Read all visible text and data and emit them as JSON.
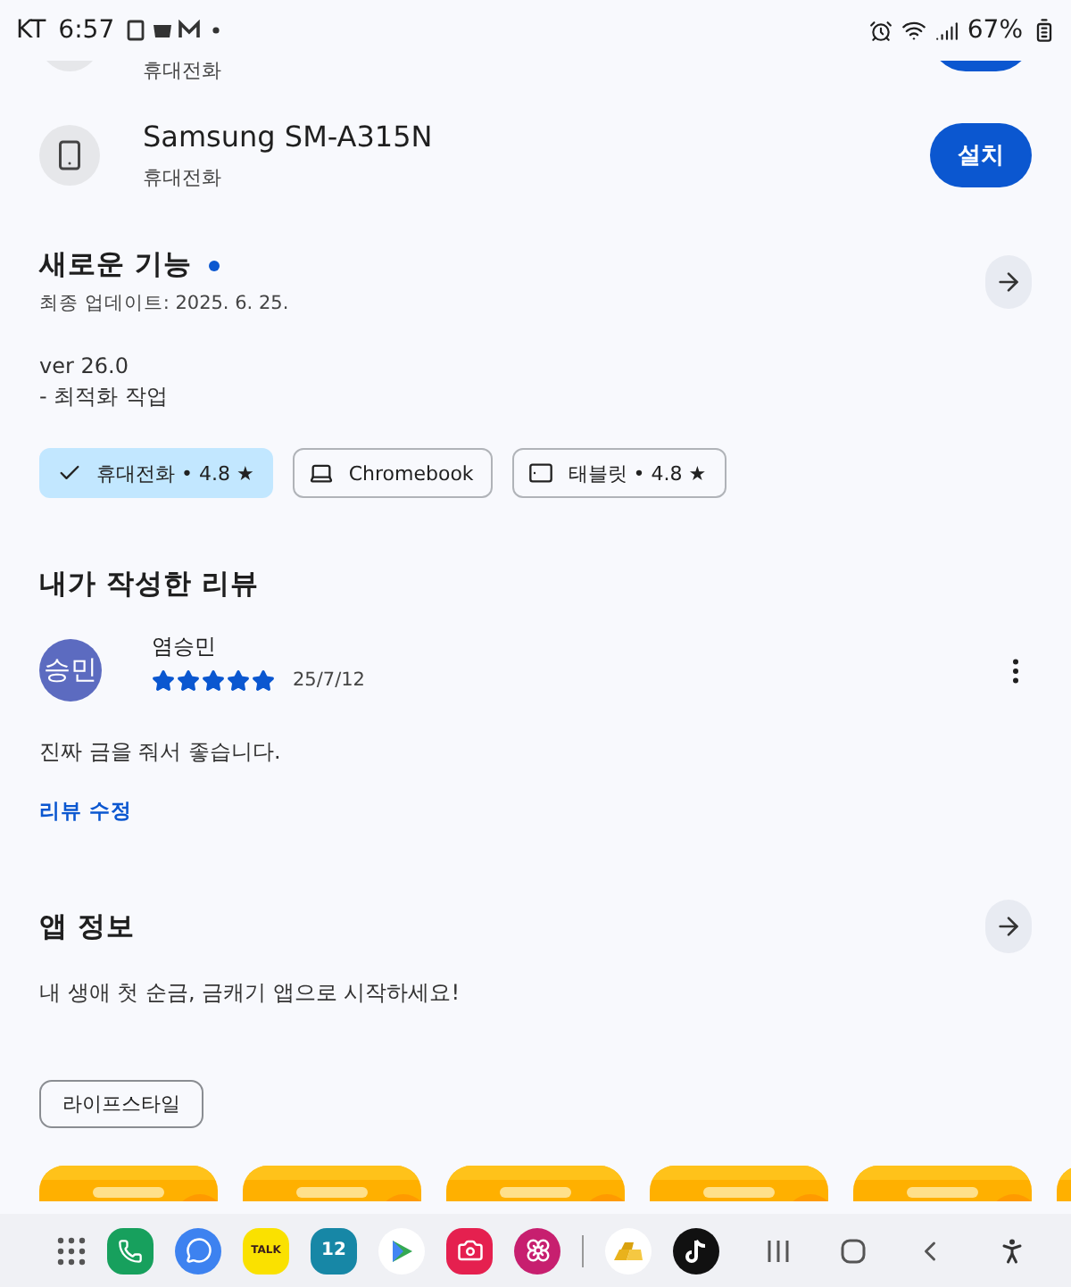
{
  "status_bar": {
    "carrier": "KT",
    "time": "6:57",
    "battery": "67%"
  },
  "devices": [
    {
      "kind": "partial",
      "type": "휴대전화"
    },
    {
      "kind": "full",
      "name": "Samsung SM-A315N",
      "type": "휴대전화",
      "button": "설치"
    }
  ],
  "whats_new": {
    "title": "새로운 기능",
    "new": true,
    "updated": "최종 업데이트: 2025. 6. 25.",
    "lines": [
      "ver 26.0",
      "- 최적화 작업"
    ]
  },
  "device_chips": [
    {
      "label": "휴대전화 • 4.8 ★",
      "selected": true
    },
    {
      "kind": "laptop",
      "label": "Chromebook",
      "selected": false
    },
    {
      "kind": "tablet",
      "label": "태블릿 • 4.8 ★",
      "selected": false
    }
  ],
  "my_review": {
    "title": "내가 작성한 리뷰",
    "avatar": "승민",
    "author": "염승민",
    "stars": 5,
    "date": "25/7/12",
    "text": "진짜 금을 줘서 좋습니다.",
    "edit_link": "리뷰 수정"
  },
  "app_info": {
    "title": "앱 정보",
    "description": "내 생애 첫 순금, 금캐기 앱으로 시작하세요!"
  },
  "tags": [
    "라이프스타일"
  ],
  "screenshots": [
    {
      "kind": "picture"
    },
    {
      "kind": "picture"
    },
    {
      "kind": "picture"
    },
    {
      "kind": "picture"
    },
    {
      "kind": "picture"
    },
    {
      "kind": "picture"
    }
  ],
  "taskbar": [
    {
      "kind": "grid"
    },
    {
      "kind": "phone"
    },
    {
      "kind": "messages"
    },
    {
      "kind": "talk",
      "label": "TALK"
    },
    {
      "kind": "calendar",
      "label": "12"
    },
    {
      "kind": "play"
    },
    {
      "kind": "camera"
    },
    {
      "kind": "flower"
    },
    {
      "kind": "divider"
    },
    {
      "kind": "gold"
    },
    {
      "kind": "tiktok"
    }
  ]
}
